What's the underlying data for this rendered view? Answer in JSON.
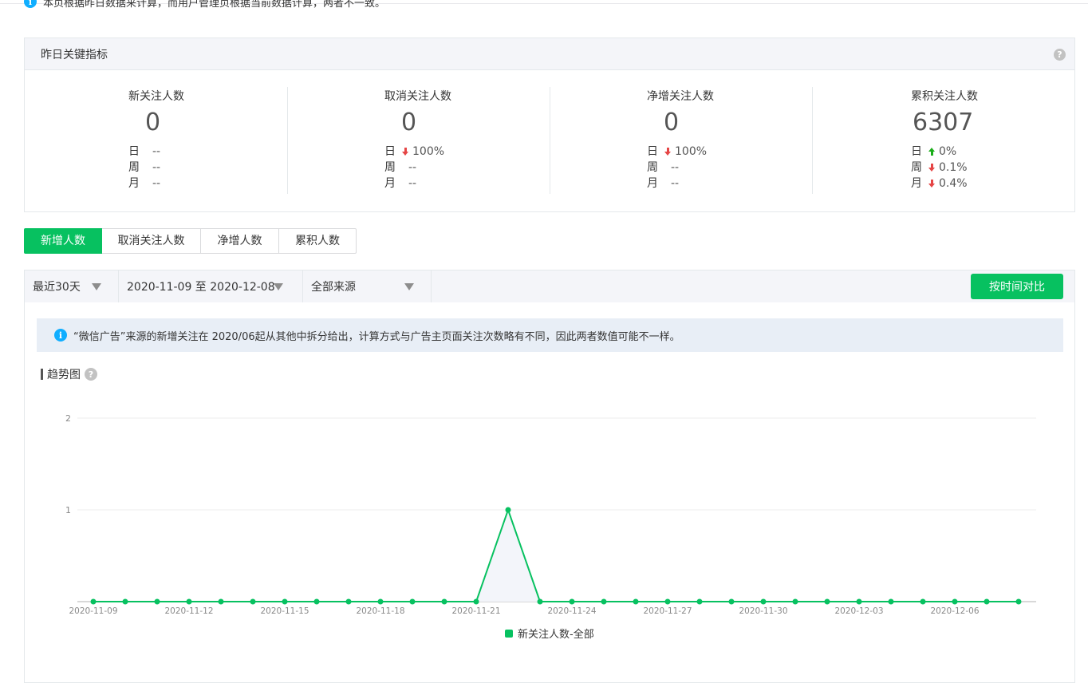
{
  "top_notice": "本页根据昨日数据来计算，而用户管理页根据当前数据计算，两者不一致。",
  "panel": {
    "title": "昨日关键指标",
    "help": "?",
    "metrics": [
      {
        "title": "新关注人数",
        "value": "0",
        "rows": [
          {
            "label": "日",
            "value": "--",
            "trend": ""
          },
          {
            "label": "周",
            "value": "--",
            "trend": ""
          },
          {
            "label": "月",
            "value": "--",
            "trend": ""
          }
        ]
      },
      {
        "title": "取消关注人数",
        "value": "0",
        "rows": [
          {
            "label": "日",
            "value": "100%",
            "trend": "down"
          },
          {
            "label": "周",
            "value": "--",
            "trend": ""
          },
          {
            "label": "月",
            "value": "--",
            "trend": ""
          }
        ]
      },
      {
        "title": "净增关注人数",
        "value": "0",
        "rows": [
          {
            "label": "日",
            "value": "100%",
            "trend": "down"
          },
          {
            "label": "周",
            "value": "--",
            "trend": ""
          },
          {
            "label": "月",
            "value": "--",
            "trend": ""
          }
        ]
      },
      {
        "title": "累积关注人数",
        "value": "6307",
        "rows": [
          {
            "label": "日",
            "value": "0%",
            "trend": "up"
          },
          {
            "label": "周",
            "value": "0.1%",
            "trend": "down"
          },
          {
            "label": "月",
            "value": "0.4%",
            "trend": "down"
          }
        ]
      }
    ]
  },
  "tabs": [
    "新增人数",
    "取消关注人数",
    "净增人数",
    "累积人数"
  ],
  "active_tab": 0,
  "filters": {
    "range": "最近30天",
    "dates": "2020-11-09 至 2020-12-08",
    "source": "全部来源",
    "compare_button": "按时间对比"
  },
  "notice": "“微信广告”来源的新增关注在 2020/06起从其他中拆分给出，计算方式与广告主页面关注次数略有不同，因此两者数值可能不一样。",
  "trend_title": "趋势图",
  "colors": {
    "accent": "#07c160",
    "down": "#e54545",
    "up": "#1aad19",
    "info": "#10aeff"
  },
  "chart_data": {
    "type": "line",
    "x": [
      "2020-11-09",
      "2020-11-10",
      "2020-11-11",
      "2020-11-12",
      "2020-11-13",
      "2020-11-14",
      "2020-11-15",
      "2020-11-16",
      "2020-11-17",
      "2020-11-18",
      "2020-11-19",
      "2020-11-20",
      "2020-11-21",
      "2020-11-22",
      "2020-11-23",
      "2020-11-24",
      "2020-11-25",
      "2020-11-26",
      "2020-11-27",
      "2020-11-28",
      "2020-11-29",
      "2020-11-30",
      "2020-12-01",
      "2020-12-02",
      "2020-12-03",
      "2020-12-04",
      "2020-12-05",
      "2020-12-06",
      "2020-12-07",
      "2020-12-08"
    ],
    "x_tick_labels": [
      "2020-11-09",
      "2020-11-12",
      "2020-11-15",
      "2020-11-18",
      "2020-11-21",
      "2020-11-24",
      "2020-11-27",
      "2020-11-30",
      "2020-12-03",
      "2020-12-06"
    ],
    "series": [
      {
        "name": "新关注人数-全部",
        "values": [
          0,
          0,
          0,
          0,
          0,
          0,
          0,
          0,
          0,
          0,
          0,
          0,
          0,
          1,
          0,
          0,
          0,
          0,
          0,
          0,
          0,
          0,
          0,
          0,
          0,
          0,
          0,
          0,
          0,
          0
        ]
      }
    ],
    "y_ticks": [
      1,
      2
    ],
    "ylim": [
      0,
      2
    ],
    "grid": true,
    "legend": "bottom-center"
  }
}
